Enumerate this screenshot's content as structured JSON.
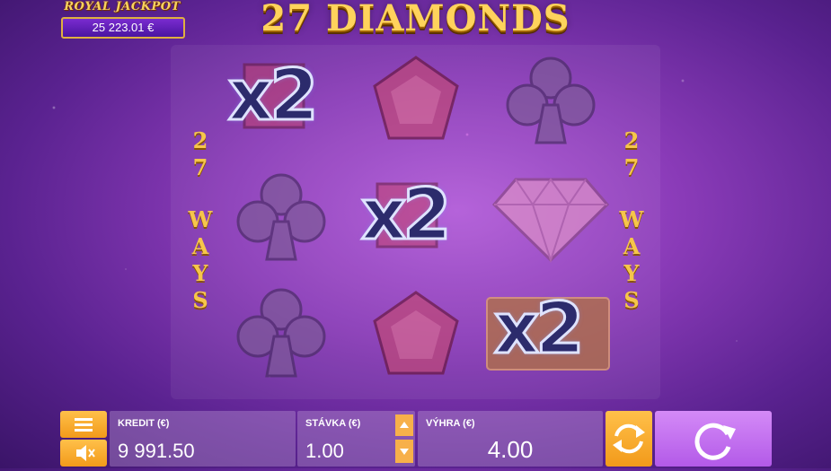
{
  "jackpot": {
    "title": "ROYAL JACKPOT",
    "amount": "25 223.01 €"
  },
  "game": {
    "title": "27 DIAMONDS"
  },
  "ways_left": [
    "2",
    "7",
    "W",
    "A",
    "Y",
    "S"
  ],
  "ways_right": [
    "2",
    "7",
    "W",
    "A",
    "Y",
    "S"
  ],
  "reels": [
    [
      "x2 on red gem",
      "club",
      "club"
    ],
    [
      "pentagon gem",
      "x2 on red gem",
      "pentagon gem"
    ],
    [
      "club",
      "diamond",
      "x2 on card"
    ]
  ],
  "multiplier_text": "x2",
  "bottom_bar": {
    "credit_label": "KREDIT (€)",
    "credit_value": "9 991.50",
    "bet_label": "STÁVKA (€)",
    "bet_value": "1.00",
    "win_label": "VÝHRA (€)",
    "win_value": "4.00"
  },
  "icons": [
    "menu-icon",
    "sound-icon",
    "autoplay-icon",
    "spin-icon",
    "bet-up-icon",
    "bet-down-icon"
  ],
  "colors": {
    "accent_orange": "#f7a52a",
    "spin_button": "#c170f0",
    "background": "#8a3bb8"
  }
}
